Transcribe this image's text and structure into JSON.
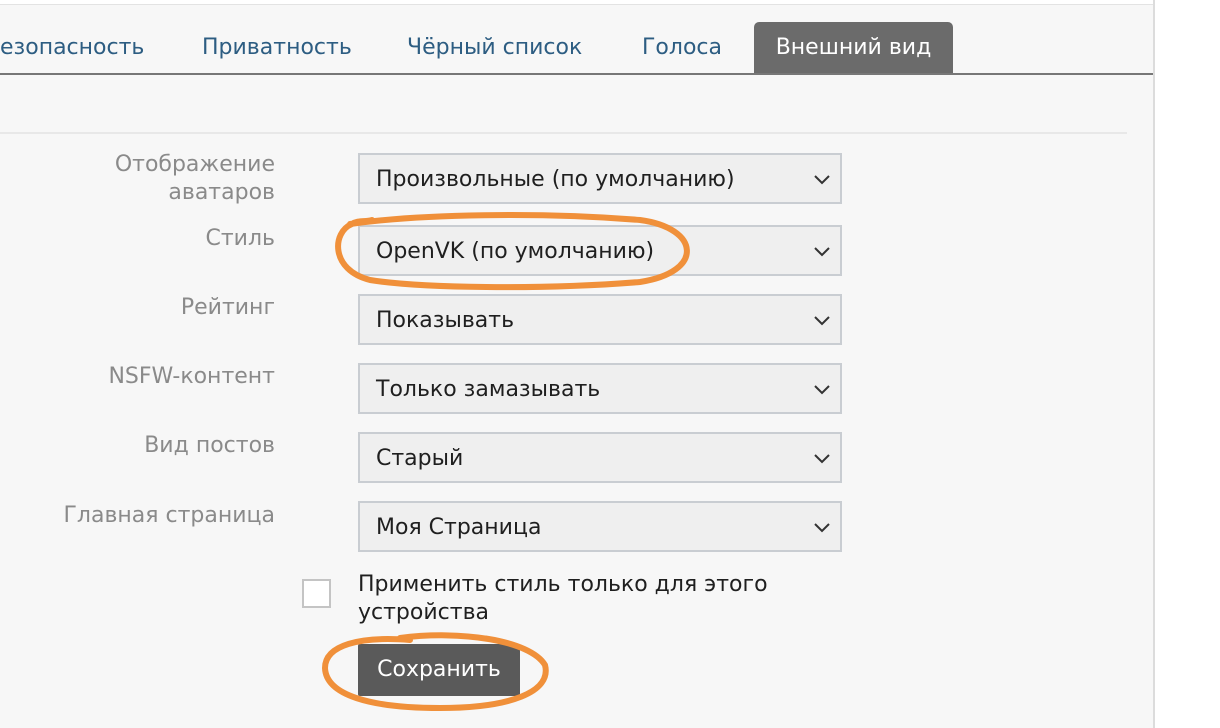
{
  "tabs": [
    {
      "label": "езопасность"
    },
    {
      "label": "Приватность"
    },
    {
      "label": "Чёрный список"
    },
    {
      "label": "Голоса"
    },
    {
      "label": "Внешний вид",
      "active": true
    }
  ],
  "settings": [
    {
      "label": "Отображение аватаров",
      "value": "Произвольные (по умолчанию)"
    },
    {
      "label": "Стиль",
      "value": "OpenVK (по умолчанию)"
    },
    {
      "label": "Рейтинг",
      "value": "Показывать"
    },
    {
      "label": "NSFW-контент",
      "value": "Только замазывать"
    },
    {
      "label": "Вид постов",
      "value": "Старый"
    },
    {
      "label": "Главная страница",
      "value": "Моя Страница"
    }
  ],
  "apply_device": {
    "label": "Применить стиль только для этого устройства",
    "checked": false
  },
  "save_label": "Сохранить",
  "colors": {
    "active_tab": "#6b6b6b",
    "tab_text": "#2d5d82",
    "annotation": "#f0903a",
    "save_button": "#5a5a5a"
  },
  "icons": {
    "select_arrow": "chevron-down-icon"
  }
}
